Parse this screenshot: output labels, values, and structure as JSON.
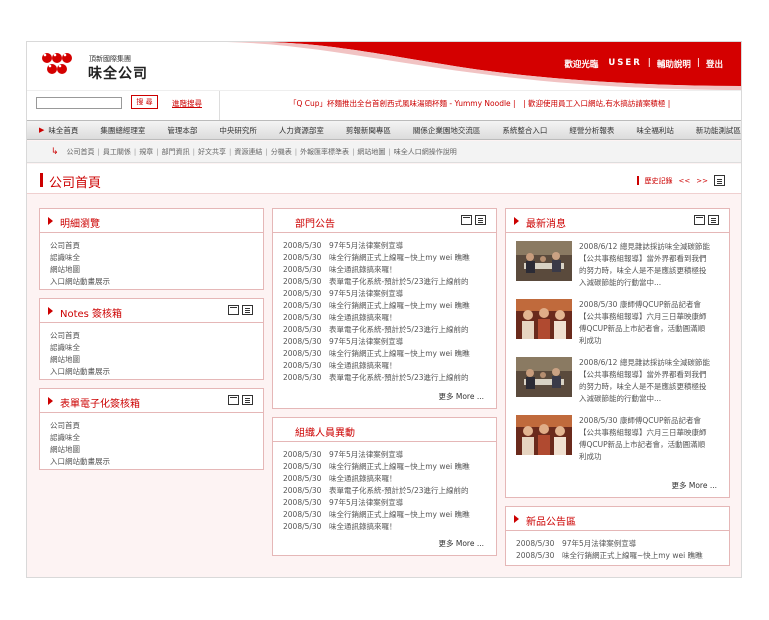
{
  "header": {
    "group_name": "頂新國際集團",
    "company_name": "味全公司",
    "welcome": "歡迎光臨",
    "user": "USER",
    "help": "輔助說明",
    "logout": "登出",
    "accent_color": "#cc0000"
  },
  "search": {
    "button_label": "搜 尋",
    "advanced_label": "進階搜尋",
    "marquee": "「Q Cup」杯麵推出全台首創西式風味湯頭杯麵 - Yummy Noodle |　| 歡迎使用員工入口網站,有水搞訪請案積極 |"
  },
  "mainnav": [
    "味全首頁",
    "集團總經理室",
    "管理本部",
    "中央研究所",
    "人力資源部室",
    "剪報新聞專區",
    "關係企業園地交流區",
    "系統整合入口",
    "經營分析報表",
    "味全福利站",
    "新功能測試區"
  ],
  "subnav": [
    "公司首頁",
    "員工關係",
    "規章",
    "部門資訊",
    "好文共享",
    "資源連結",
    "分機表",
    "外報匯率標準表",
    "網站地圖",
    "味全人口網操作說明"
  ],
  "page": {
    "title": "公司首頁",
    "history_label": "歷史記錄",
    "prev": "<<",
    "next": ">>"
  },
  "panels": {
    "browse": {
      "title": "明細瀏覽",
      "items": [
        "公司首頁",
        "認識味全",
        "網站地圖",
        "入口網站動畫展示"
      ]
    },
    "notes": {
      "title": "Notes 簽核箱",
      "items": [
        "公司首頁",
        "認識味全",
        "網站地圖",
        "入口網站動畫展示"
      ]
    },
    "eform": {
      "title": "表單電子化簽核箱",
      "items": [
        "公司首頁",
        "認識味全",
        "網站地圖",
        "入口網站動畫展示"
      ]
    },
    "dept": {
      "title": "部門公告",
      "items": [
        "2008/5/30　97年5月法律案例宣導",
        "2008/5/30　味全行銷網正式上線囉~快上my wei 瞧瞧",
        "2008/5/30　味全通訊錄搞來囉！",
        "2008/5/30　表單電子化系統-預計於5/23進行上線前的",
        "2008/5/30　97年5月法律案例宣導",
        "2008/5/30　味全行銷網正式上線囉~快上my wei 瞧瞧",
        "2008/5/30　味全通訊錄搞來囉！",
        "2008/5/30　表單電子化系統-預計於5/23進行上線前的",
        "2008/5/30　97年5月法律案例宣導",
        "2008/5/30　味全行銷網正式上線囉~快上my wei 瞧瞧",
        "2008/5/30　味全通訊錄搞來囉！",
        "2008/5/30　表單電子化系統-預計於5/23進行上線前的"
      ],
      "more": "更多 More ..."
    },
    "org": {
      "title": "組織人員異動",
      "items": [
        "2008/5/30　97年5月法律案例宣導",
        "2008/5/30　味全行銷網正式上線囉~快上my wei 瞧瞧",
        "2008/5/30　味全通訊錄搞來囉！",
        "2008/5/30　表單電子化系統-預計於5/23進行上線前的",
        "2008/5/30　97年5月法律案例宣導",
        "2008/5/30　味全行銷網正式上線囉~快上my wei 瞧瞧",
        "2008/5/30　味全通訊錄搞來囉！"
      ],
      "more": "更多 More ..."
    },
    "latest": {
      "title": "最新消息",
      "items": [
        {
          "l1": "2008/6/12 總見雜誌採訪味全減碳節能",
          "l2": "【公共事務組報導】當外界都看到我們",
          "l3": "的努力時，味全人是不是應該更積極投",
          "l4": "入減碳節能的行動當中..."
        },
        {
          "l1": "2008/5/30 康師傅QCUP新品記者會",
          "l2": "【公共事務組報導】六月三日華映康師",
          "l3": "傅QCUP新品上市記者會，活動圓滿順",
          "l4": "利成功"
        },
        {
          "l1": "2008/6/12 總見雜誌採訪味全減碳節能",
          "l2": "【公共事務組報導】當外界都看到我們",
          "l3": "的努力時，味全人是不是應該更積極投",
          "l4": "入減碳節能的行動當中..."
        },
        {
          "l1": "2008/5/30 康師傅QCUP新品記者會",
          "l2": "【公共事務組報導】六月三日華映康師",
          "l3": "傅QCUP新品上市記者會，活動圓滿順",
          "l4": "利成功"
        }
      ],
      "more": "更多 More ..."
    },
    "newprod": {
      "title": "新品公告區",
      "items": [
        "2008/5/30　97年5月法律案例宣導",
        "2008/5/30　味全行銷網正式上線囉~快上my wei 瞧瞧"
      ]
    }
  }
}
